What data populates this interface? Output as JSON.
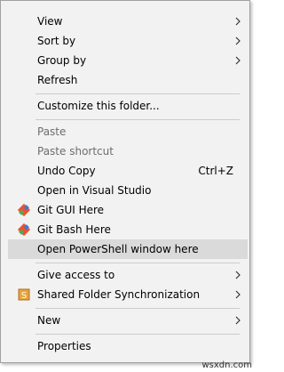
{
  "menu": {
    "items": [
      {
        "label": "View",
        "submenu": true
      },
      {
        "label": "Sort by",
        "submenu": true
      },
      {
        "label": "Group by",
        "submenu": true
      },
      {
        "label": "Refresh"
      },
      {
        "label": "Customize this folder..."
      },
      {
        "label": "Paste",
        "disabled": true
      },
      {
        "label": "Paste shortcut",
        "disabled": true
      },
      {
        "label": "Undo Copy",
        "shortcut": "Ctrl+Z"
      },
      {
        "label": "Open in Visual Studio"
      },
      {
        "label": "Git GUI Here",
        "icon": "git-icon"
      },
      {
        "label": "Git Bash Here",
        "icon": "git-icon"
      },
      {
        "label": "Open PowerShell window here",
        "highlighted": true
      },
      {
        "label": "Give access to",
        "submenu": true
      },
      {
        "label": "Shared Folder Synchronization",
        "submenu": true,
        "icon": "sync-icon"
      },
      {
        "label": "New",
        "submenu": true
      },
      {
        "label": "Properties"
      }
    ]
  },
  "watermark": "wsxdn.com",
  "colors": {
    "menu_bg": "#f2f2f2",
    "highlight": "#dadada",
    "disabled_text": "#6d6d6d",
    "git_orange": "#f05033",
    "git_blue": "#3d7cc9",
    "git_green": "#4bae4f",
    "sync_orange": "#e8a33d"
  }
}
